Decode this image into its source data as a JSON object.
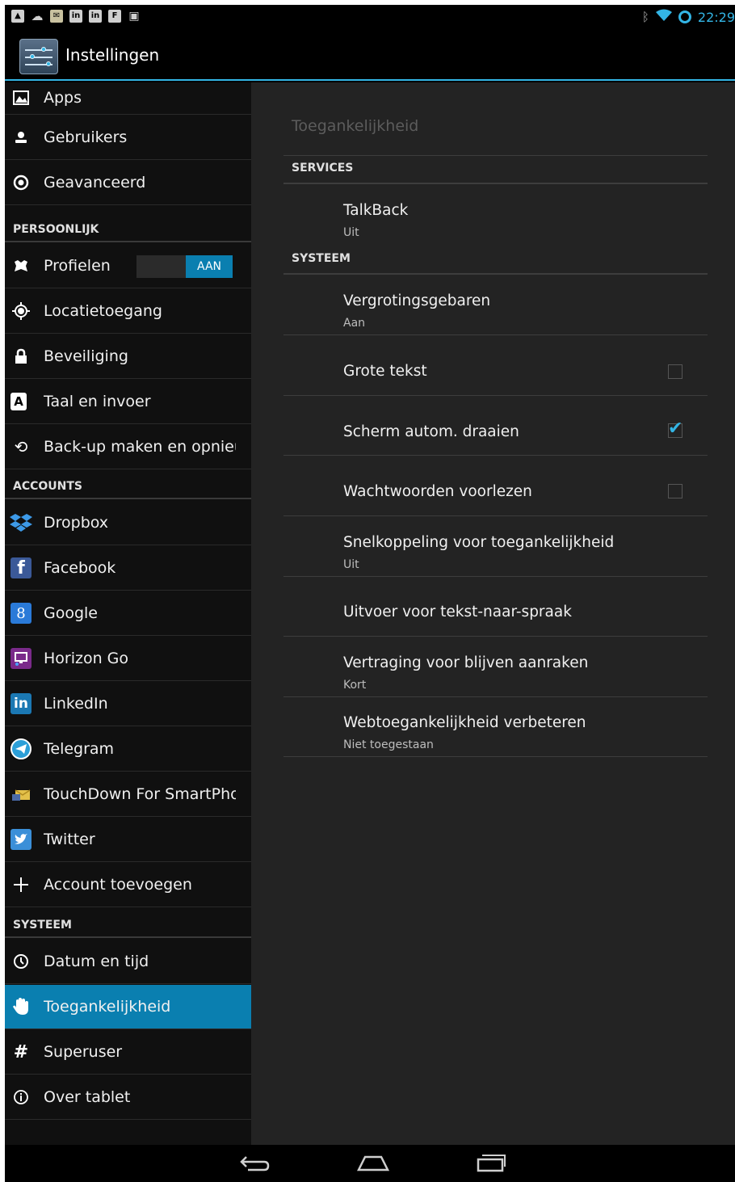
{
  "status_bar": {
    "icons": [
      "gallery-icon",
      "cloud-upload-icon",
      "email-icon",
      "linkedin-icon",
      "linkedin-icon",
      "flipboard-icon",
      "camera-icon"
    ],
    "time": "22:29"
  },
  "action_bar": {
    "title": "Instellingen"
  },
  "sidebar": {
    "items": [
      {
        "label": "Apps",
        "icon": "apps-icon"
      },
      {
        "label": "Gebruikers",
        "icon": "users-icon"
      },
      {
        "label": "Geavanceerd",
        "icon": "advanced-icon"
      }
    ],
    "header_personal": "PERSOONLIJK",
    "personal_items": [
      {
        "label": "Profielen",
        "icon": "profiles-icon",
        "toggle": "AAN"
      },
      {
        "label": "Locatietoegang",
        "icon": "location-icon"
      },
      {
        "label": "Beveiliging",
        "icon": "lock-icon"
      },
      {
        "label": "Taal en invoer",
        "icon": "language-icon"
      },
      {
        "label": "Back-up maken en opnieuw instellen",
        "icon": "backup-icon"
      }
    ],
    "header_accounts": "ACCOUNTS",
    "accounts": [
      {
        "label": "Dropbox",
        "icon": "dropbox-icon"
      },
      {
        "label": "Facebook",
        "icon": "facebook-icon"
      },
      {
        "label": "Google",
        "icon": "google-icon"
      },
      {
        "label": "Horizon Go",
        "icon": "horizon-go-icon"
      },
      {
        "label": "LinkedIn",
        "icon": "linkedin-icon"
      },
      {
        "label": "Telegram",
        "icon": "telegram-icon"
      },
      {
        "label": "TouchDown For SmartPhones",
        "icon": "touchdown-icon"
      },
      {
        "label": "Twitter",
        "icon": "twitter-icon"
      },
      {
        "label": "Account toevoegen",
        "icon": "plus-icon"
      }
    ],
    "header_system": "SYSTEEM",
    "system_items": [
      {
        "label": "Datum en tijd",
        "icon": "clock-icon"
      },
      {
        "label": "Toegankelijkheid",
        "icon": "hand-icon",
        "selected": true
      },
      {
        "label": "Superuser",
        "icon": "hash-icon"
      },
      {
        "label": "Over tablet",
        "icon": "info-icon"
      }
    ]
  },
  "main": {
    "title": "Toegankelijkheid",
    "services_header": "SERVICES",
    "talkback": {
      "title": "TalkBack",
      "summary": "Uit"
    },
    "system_header": "SYSTEEM",
    "prefs": [
      {
        "title": "Vergrotingsgebaren",
        "summary": "Aan"
      },
      {
        "title": "Grote tekst",
        "checked": false
      },
      {
        "title": "Scherm autom. draaien",
        "checked": true
      },
      {
        "title": "Wachtwoorden voorlezen",
        "checked": false
      },
      {
        "title": "Snelkoppeling voor toegankelijkheid",
        "summary": "Uit"
      },
      {
        "title": "Uitvoer voor tekst-naar-spraak"
      },
      {
        "title": "Vertraging voor blijven aanraken",
        "summary": "Kort"
      },
      {
        "title": "Webtoegankelijkheid verbeteren",
        "summary": "Niet toegestaan"
      }
    ]
  },
  "navbar": {
    "buttons": [
      "back-icon",
      "home-icon",
      "recent-apps-icon"
    ]
  },
  "colors": {
    "accent": "#33b5e5",
    "selected": "#0a7fb0",
    "pane_bg": "#232323",
    "list_bg": "#101010"
  }
}
